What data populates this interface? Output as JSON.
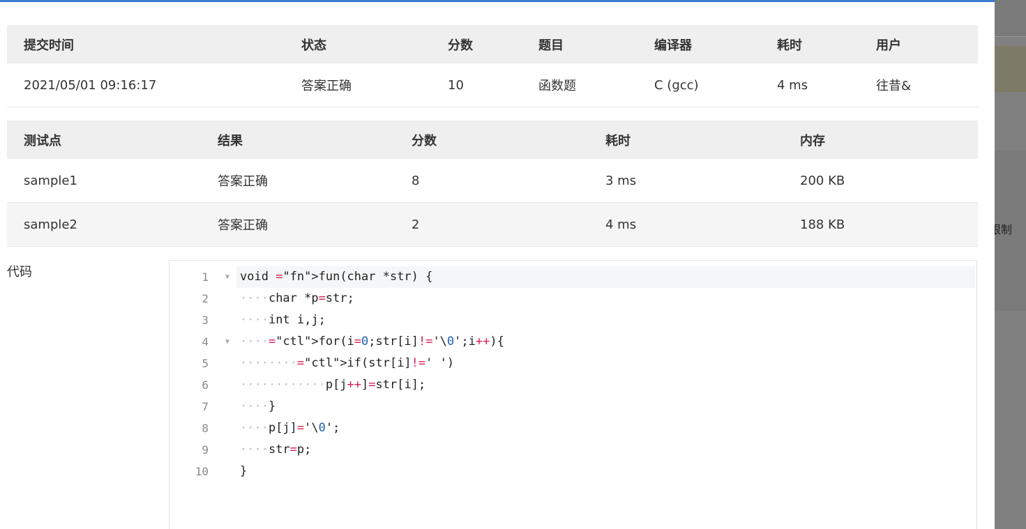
{
  "summary": {
    "headers": [
      "提交时间",
      "状态",
      "分数",
      "题目",
      "编译器",
      "耗时",
      "用户"
    ],
    "row": {
      "time": "2021/05/01 09:16:17",
      "status": "答案正确",
      "score": "10",
      "problem": "函数题",
      "compiler": "C (gcc)",
      "elapsed": "4 ms",
      "user": "往昔&"
    }
  },
  "tests": {
    "headers": [
      "测试点",
      "结果",
      "分数",
      "耗时",
      "内存"
    ],
    "rows": [
      {
        "name": "sample1",
        "result": "答案正确",
        "score": "8",
        "time": "3 ms",
        "memory": "200 KB"
      },
      {
        "name": "sample2",
        "result": "答案正确",
        "score": "2",
        "time": "4 ms",
        "memory": "188 KB"
      }
    ]
  },
  "code": {
    "label": "代码",
    "lines": [
      "void fun(char *str) {",
      "    char *p=str;",
      "    int i,j;",
      "    for(i=0;str[i]!='\\0';i++){",
      "        if(str[i]!=' ')",
      "            p[j++]=str[i];",
      "    }",
      "    p[j]='\\0';",
      "    str=p;",
      "}"
    ],
    "line_numbers": [
      "1",
      "2",
      "3",
      "4",
      "5",
      "6",
      "7",
      "8",
      "9",
      "10"
    ]
  },
  "background_cut_text": "限制",
  "colors": {
    "accent": "#3a7bd5",
    "status_ok": "#e53935",
    "keyword_fn": "#5a3fb8",
    "operator": "#d6204e",
    "number": "#1a5fb4"
  }
}
